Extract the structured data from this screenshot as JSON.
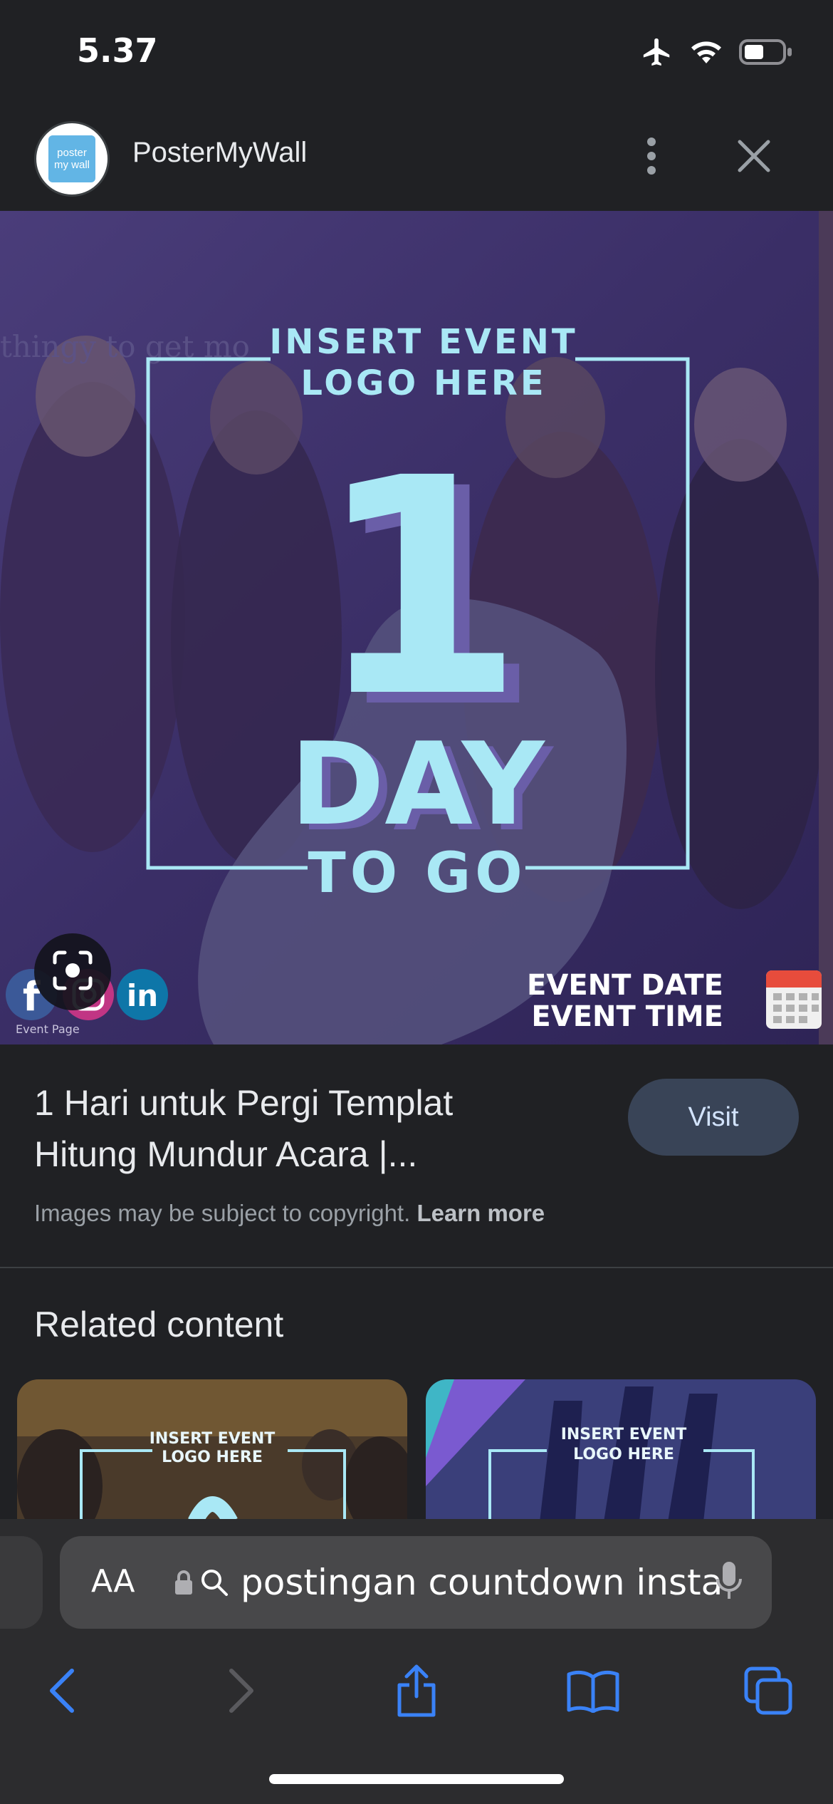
{
  "status_bar": {
    "time": "5.37",
    "icons": [
      "airplane-icon",
      "wifi-icon",
      "battery-icon"
    ]
  },
  "site": {
    "logo_line1": "poster",
    "logo_line2": "my wall",
    "name": "PosterMyWall",
    "menu_icon": "more-vertical-icon",
    "close_icon": "close-icon"
  },
  "hero": {
    "background_text": "thingy to get mo",
    "insert_line1": "INSERT EVENT",
    "insert_line2": "LOGO HERE",
    "big_number": "1",
    "day_text": "DAY",
    "to_go_text": "TO GO",
    "event_date": "EVENT DATE",
    "event_time": "EVENT TIME",
    "event_page": "Event Page",
    "social_icons": [
      "facebook-icon",
      "instagram-icon",
      "linkedin-icon"
    ],
    "accent_color": "#a9e8f5"
  },
  "result": {
    "title_line1": "1 Hari untuk Pergi Templat",
    "title_line2": "Hitung Mundur Acara |...",
    "visit_label": "Visit",
    "copyright_text": "Images may be subject to copyright.",
    "learn_more": "Learn more"
  },
  "related": {
    "heading": "Related content",
    "cards": [
      {
        "insert_line1": "INSERT EVENT",
        "insert_line2": "LOGO HERE"
      },
      {
        "insert_line1": "INSERT EVENT",
        "insert_line2": "LOGO HERE"
      }
    ]
  },
  "safari": {
    "aa_label": "AA",
    "url": "postingan countdown insta",
    "toolbar_icons": [
      "back-icon",
      "forward-icon",
      "share-icon",
      "bookmarks-icon",
      "tabs-icon"
    ],
    "accent_color": "#3a82f7"
  }
}
